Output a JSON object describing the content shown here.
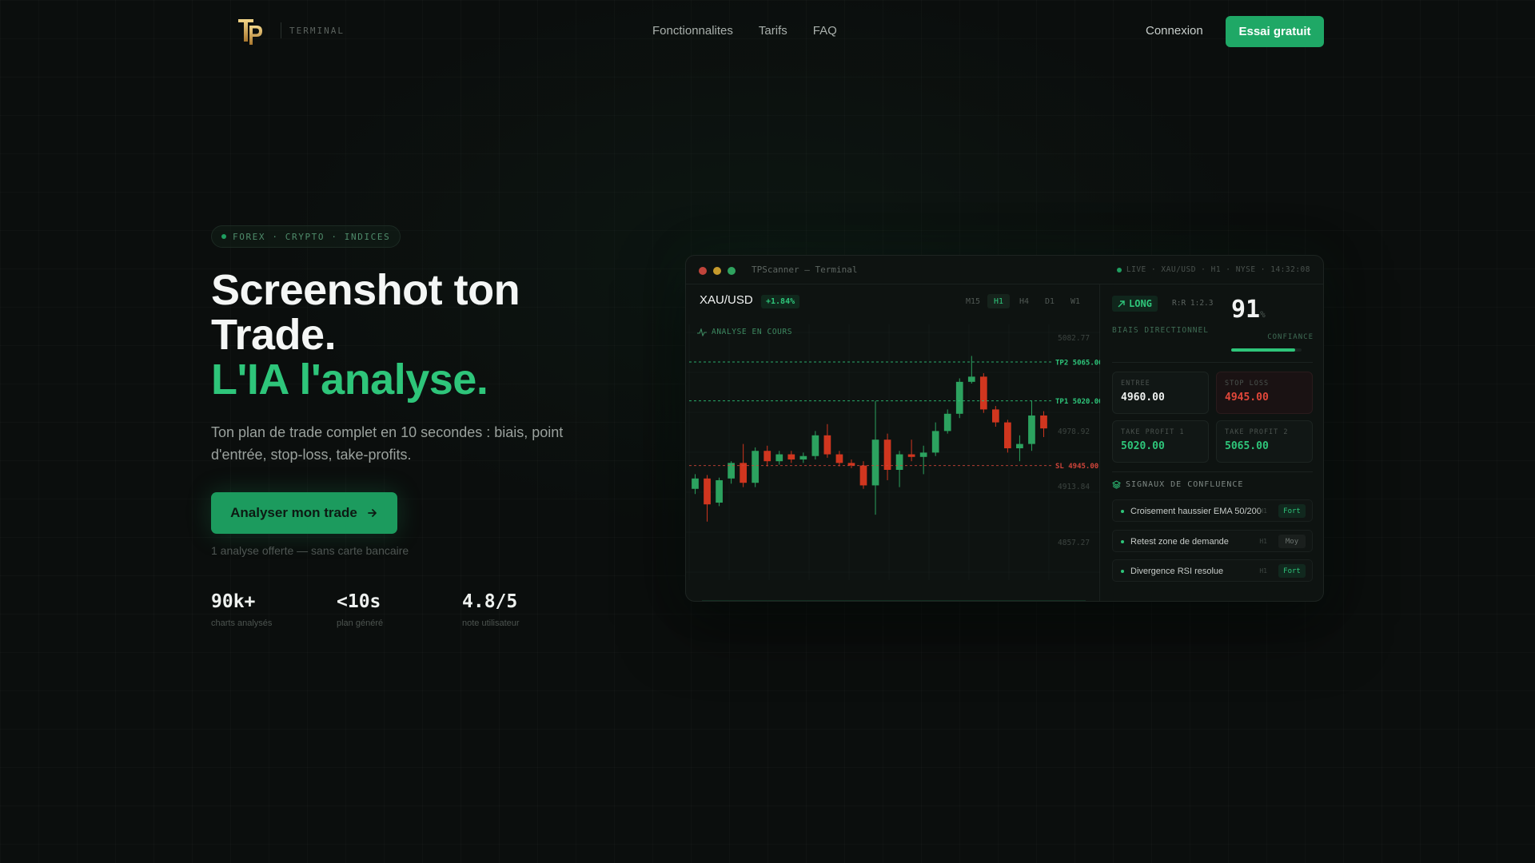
{
  "nav": {
    "logo_sub": "TERMINAL",
    "links": [
      "Fonctionnalites",
      "Tarifs",
      "FAQ"
    ],
    "login": "Connexion",
    "cta": "Essai gratuit"
  },
  "hero": {
    "badge": "FOREX · CRYPTO · INDICES",
    "title_line1": "Screenshot ton",
    "title_line2": "Trade.",
    "title_line3": "L'IA l'analyse.",
    "subtitle": "Ton plan de trade complet en 10 secondes : biais, point d'entrée, stop-loss, take-profits.",
    "cta": "Analyser mon trade",
    "note": "1 analyse offerte — sans carte bancaire",
    "stats": [
      {
        "value": "90k+",
        "label": "charts analysés"
      },
      {
        "value": "<10s",
        "label": "plan généré"
      },
      {
        "value": "4.8/5",
        "label": "note utilisateur"
      }
    ]
  },
  "terminal": {
    "title": "TPScanner — Terminal",
    "live": "LIVE · XAU/USD · H1 · NYSE · 14:32:08",
    "pair": "XAU/USD",
    "change": "+1.84%",
    "timeframes": [
      "M15",
      "H1",
      "H4",
      "D1",
      "W1"
    ],
    "active_tf": "H1",
    "analyse": "ANALYSE EN COURS",
    "direction": "LONG",
    "rr": "R:R 1:2.3",
    "bias_label": "BIAIS DIRECTIONNEL",
    "confidence": "91",
    "confidence_unit": "%",
    "confidence_label": "CONFIANCE",
    "confidence_fraction": 0.91,
    "levels": {
      "entry": {
        "label": "ENTREE",
        "value": "4960.00"
      },
      "sl": {
        "label": "STOP LOSS",
        "value": "4945.00"
      },
      "tp1": {
        "label": "TAKE PROFIT 1",
        "value": "5020.00"
      },
      "tp2": {
        "label": "TAKE PROFIT 2",
        "value": "5065.00"
      }
    },
    "signals_title": "SIGNAUX DE CONFLUENCE",
    "signals": [
      {
        "text": "Croisement haussier EMA 50/200",
        "tf": "H1",
        "strength": "Fort"
      },
      {
        "text": "Retest zone de demande",
        "tf": "H1",
        "strength": "Moy"
      },
      {
        "text": "Divergence RSI resolue",
        "tf": "H1",
        "strength": "Fort"
      }
    ],
    "colors": {
      "up": "#2ca25f",
      "down": "#d0361f",
      "accent": "#2ec57a"
    }
  },
  "chart_data": {
    "type": "candlestick",
    "y_ticks": [
      "5082.77",
      "4978.92",
      "4913.84",
      "4857.27"
    ],
    "lines": [
      {
        "label": "TP2 5065.00",
        "value": 5065.0,
        "kind": "tp"
      },
      {
        "label": "TP1 5020.00",
        "value": 5020.0,
        "kind": "tp"
      },
      {
        "label": "SL 4945.00",
        "value": 4945.0,
        "kind": "sl"
      }
    ],
    "ylim": [
      4840,
      5090
    ],
    "candles": [
      [
        4918,
        4930,
        4935,
        4912
      ],
      [
        4930,
        4900,
        4934,
        4880
      ],
      [
        4902,
        4928,
        4931,
        4898
      ],
      [
        4930,
        4948,
        4950,
        4924
      ],
      [
        4948,
        4925,
        4970,
        4920
      ],
      [
        4925,
        4962,
        4966,
        4920
      ],
      [
        4962,
        4950,
        4968,
        4944
      ],
      [
        4950,
        4958,
        4962,
        4946
      ],
      [
        4958,
        4952,
        4962,
        4948
      ],
      [
        4952,
        4956,
        4960,
        4948
      ],
      [
        4956,
        4980,
        4985,
        4952
      ],
      [
        4980,
        4958,
        4993,
        4954
      ],
      [
        4958,
        4948,
        4962,
        4944
      ],
      [
        4948,
        4945,
        4952,
        4942
      ],
      [
        4945,
        4922,
        4950,
        4918
      ],
      [
        4922,
        4975,
        5020,
        4888
      ],
      [
        4975,
        4940,
        4982,
        4928
      ],
      [
        4940,
        4958,
        4962,
        4920
      ],
      [
        4958,
        4955,
        4975,
        4950
      ],
      [
        4955,
        4960,
        4968,
        4935
      ],
      [
        4960,
        4985,
        4995,
        4956
      ],
      [
        4985,
        5005,
        5010,
        4982
      ],
      [
        5005,
        5042,
        5046,
        5000
      ],
      [
        5042,
        5048,
        5072,
        5040
      ],
      [
        5048,
        5010,
        5052,
        5006
      ],
      [
        5010,
        4995,
        5014,
        4990
      ],
      [
        4995,
        4965,
        4998,
        4960
      ],
      [
        4965,
        4970,
        4980,
        4950
      ],
      [
        4970,
        5003,
        5020,
        4962
      ],
      [
        5003,
        4988,
        5008,
        4978
      ]
    ]
  }
}
